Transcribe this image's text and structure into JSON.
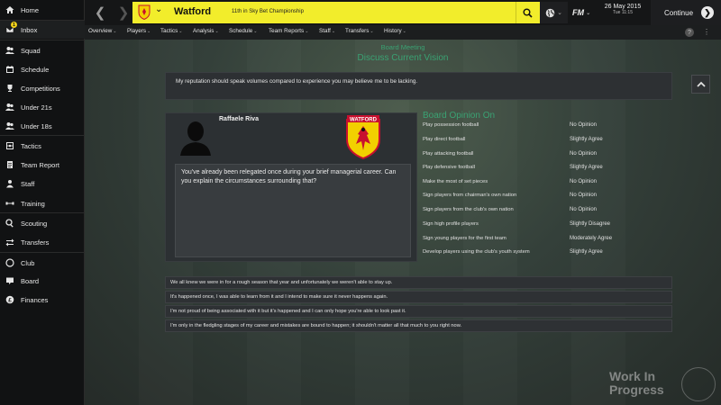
{
  "sidebar": {
    "items": [
      {
        "label": "Home",
        "icon": "home-icon"
      },
      {
        "label": "Inbox",
        "icon": "inbox-icon",
        "badge": "1"
      },
      {
        "label": "Squad",
        "icon": "squad-icon"
      },
      {
        "label": "Schedule",
        "icon": "calendar-icon"
      },
      {
        "label": "Competitions",
        "icon": "trophy-icon"
      },
      {
        "label": "Under 21s",
        "icon": "squad-icon"
      },
      {
        "label": "Under 18s",
        "icon": "squad-icon"
      },
      {
        "label": "Tactics",
        "icon": "tactics-icon"
      },
      {
        "label": "Team Report",
        "icon": "report-icon"
      },
      {
        "label": "Staff",
        "icon": "staff-icon"
      },
      {
        "label": "Training",
        "icon": "training-icon"
      },
      {
        "label": "Scouting",
        "icon": "search-icon"
      },
      {
        "label": "Transfers",
        "icon": "transfers-icon"
      },
      {
        "label": "Club",
        "icon": "club-icon"
      },
      {
        "label": "Board",
        "icon": "board-icon"
      },
      {
        "label": "Finances",
        "icon": "finances-icon"
      }
    ]
  },
  "header": {
    "club_name": "Watford",
    "club_position": "11th in Sky Bet Championship",
    "logo_text": "FM",
    "date": "26 May 2015",
    "time": "Tue 11:15",
    "continue_label": "Continue",
    "accent_color": "#f2ed2b"
  },
  "subnav": {
    "items": [
      "Overview",
      "Players",
      "Tactics",
      "Analysis",
      "Schedule",
      "Team Reports",
      "Staff",
      "Transfers",
      "History"
    ],
    "help_label": "?"
  },
  "meeting": {
    "title": "Board Meeting",
    "subtitle": "Discuss Current Vision",
    "statement": "My reputation should speak volumes compared to experience you may believe me to be lacking.",
    "chairman_name": "Raffaele Riva",
    "crest_text": "WATFORD",
    "question": "You've already been relegated once during your brief managerial career. Can you explain the circumstances surrounding that?"
  },
  "board_opinion": {
    "title": "Board Opinion On",
    "rows": [
      {
        "topic": "Play possession football",
        "opinion": "No Opinion"
      },
      {
        "topic": "Play direct football",
        "opinion": "Slightly Agree"
      },
      {
        "topic": "Play attacking football",
        "opinion": "No Opinion"
      },
      {
        "topic": "Play defensive football",
        "opinion": "Slightly Agree"
      },
      {
        "topic": "Make the most of set pieces",
        "opinion": "No Opinion"
      },
      {
        "topic": "Sign players from chairman's own nation",
        "opinion": "No Opinion"
      },
      {
        "topic": "Sign players from the club's own nation",
        "opinion": "No Opinion"
      },
      {
        "topic": "Sign high profile players",
        "opinion": "Slightly Disagree"
      },
      {
        "topic": "Sign young players for the first team",
        "opinion": "Moderately Agree"
      },
      {
        "topic": "Develop players using the club's youth system",
        "opinion": "Slightly Agree"
      }
    ]
  },
  "replies": [
    "We all knew we were in for a rough season that year and unfortunately we weren't able to stay up.",
    "It's happened once, I was able to learn from it and I intend to make sure it never happens again.",
    "I'm not proud of being associated with it but it's happened and I can only hope you're able to look past it.",
    "I'm only in the fledgling stages of my career and mistakes are bound to happen; it shouldn't matter all that much to you right now."
  ],
  "watermark": {
    "line1": "Work In",
    "line2": "Progress"
  }
}
